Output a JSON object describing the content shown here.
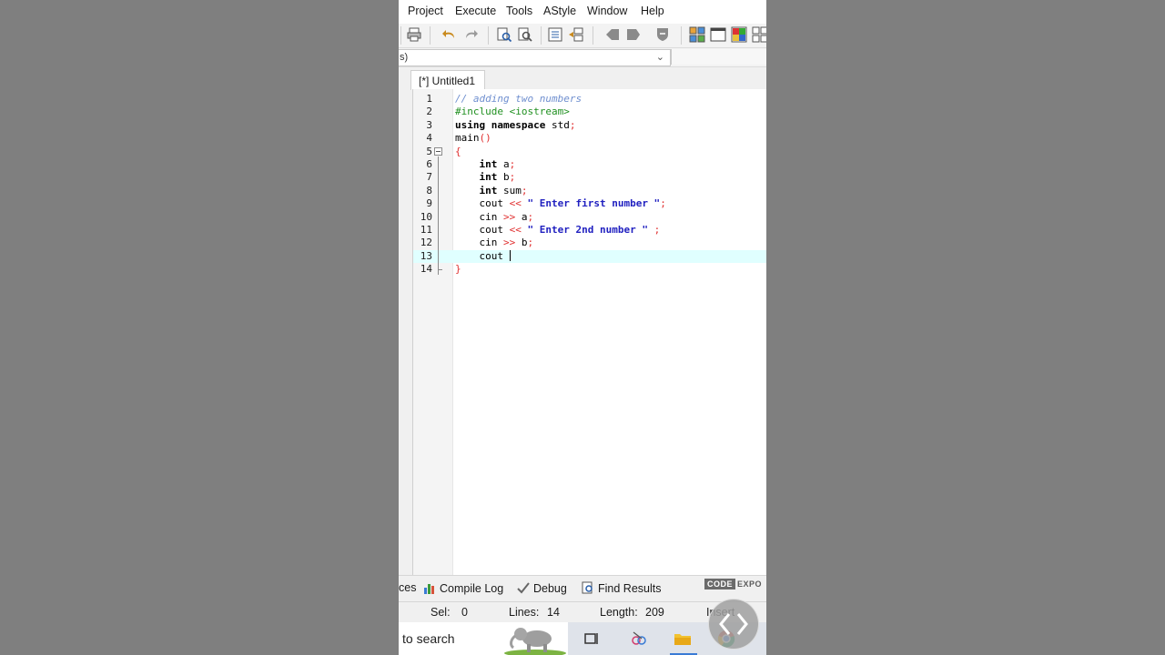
{
  "menu": [
    "Project",
    "Execute",
    "Tools",
    "AStyle",
    "Window",
    "Help"
  ],
  "combo": {
    "value": "s)"
  },
  "editor_tab": {
    "label": "[*] Untitled1"
  },
  "code_lines": [
    {
      "num": "1",
      "text": "// adding two numbers"
    },
    {
      "num": "2",
      "text": "#include <iostream>"
    },
    {
      "num": "3",
      "text": "using namespace std;"
    },
    {
      "num": "4",
      "text": "main()"
    },
    {
      "num": "5",
      "text": "{"
    },
    {
      "num": "6",
      "text": "    int a;"
    },
    {
      "num": "7",
      "text": "    int b;"
    },
    {
      "num": "8",
      "text": "    int sum;"
    },
    {
      "num": "9",
      "text": "    cout << \" Enter first number \";"
    },
    {
      "num": "10",
      "text": "    cin >> a;"
    },
    {
      "num": "11",
      "text": "    cout << \" Enter 2nd number \" ;"
    },
    {
      "num": "12",
      "text": "    cin >> b;"
    },
    {
      "num": "13",
      "text": "    cout "
    },
    {
      "num": "14",
      "text": "}"
    }
  ],
  "bottom_tabs": {
    "resources": "ces",
    "compile_log": "Compile Log",
    "debug": "Debug",
    "find_results": "Find Results"
  },
  "watermark": {
    "part1": "CODE",
    "part2": "EXPO"
  },
  "status": {
    "sel_label": "Sel:",
    "sel_value": "0",
    "lines_label": "Lines:",
    "lines_value": "14",
    "length_label": "Length:",
    "length_value": "209",
    "mode": "Insert"
  },
  "taskbar": {
    "search_placeholder": "to search"
  },
  "colors": {
    "comment": "#6f8fcf",
    "preprocessor": "#209020",
    "symbol": "#e03030",
    "string": "#2020c0",
    "current_line": "#e0ffff",
    "background": "#7f7f7f"
  }
}
